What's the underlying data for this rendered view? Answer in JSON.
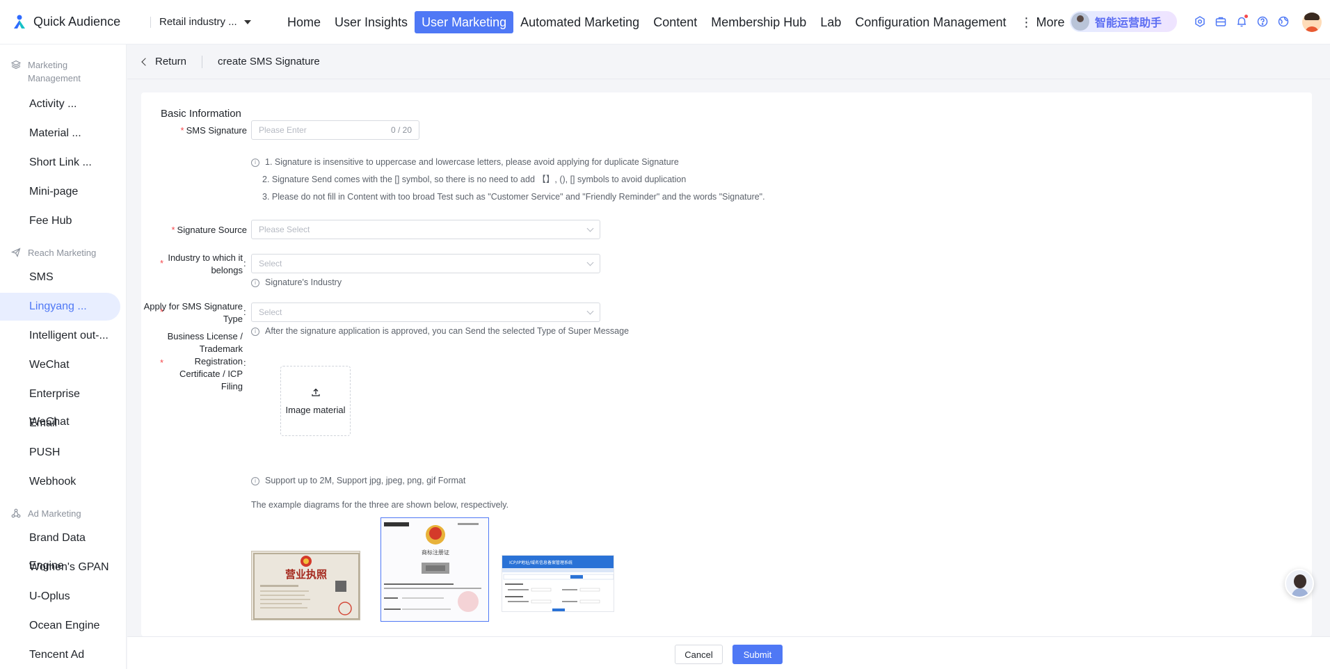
{
  "app": {
    "name": "Quick Audience",
    "org_selector": "Retail industry ...",
    "assistant_label": "智能运营助手"
  },
  "nav": [
    {
      "label": "Home"
    },
    {
      "label": "User Insights"
    },
    {
      "label": "User Marketing",
      "active": true
    },
    {
      "label": "Automated Marketing"
    },
    {
      "label": "Content"
    },
    {
      "label": "Membership Hub"
    },
    {
      "label": "Lab"
    },
    {
      "label": "Configuration Management"
    },
    {
      "label": "⋮ More"
    }
  ],
  "top_icons": [
    "settings-hex-icon",
    "toolbox-icon",
    "bell-icon",
    "help-icon",
    "globe-icon"
  ],
  "sidebar": {
    "groups": [
      {
        "label": "Marketing Management",
        "icon": "layers-icon",
        "items": [
          "Activity ...",
          "Material ...",
          "Short Link ...",
          "Mini-page",
          "Fee Hub"
        ]
      },
      {
        "label": "Reach Marketing",
        "icon": "send-icon",
        "items": [
          "SMS",
          "Lingyang ...",
          "Intelligent out-...",
          "WeChat",
          "Enterprise WeChat",
          "Email",
          "PUSH",
          "Webhook"
        ]
      },
      {
        "label": "Ad Marketing",
        "icon": "nodes-icon",
        "items": [
          "Brand Data Engine",
          "Women's GPAN",
          "U-Oplus",
          "Ocean Engine",
          "Tencent Ad"
        ]
      }
    ],
    "active_item": "Lingyang ..."
  },
  "breadcrumb": {
    "back_label": "Return",
    "title": "create SMS Signature"
  },
  "form": {
    "section_title": "Basic Information",
    "sms_signature": {
      "label": "SMS Signature",
      "placeholder": "Please Enter",
      "counter": "0 / 20",
      "tips": [
        "1. Signature is insensitive to uppercase and lowercase letters, please avoid applying for duplicate Signature",
        "2. Signature Send comes with the [] symbol, so there is no need to add 【】, (), [] symbols to avoid duplication",
        "3. Please do not fill in Content with too broad Test such as \"Customer Service\" and \"Friendly Reminder\" and the words \"Signature\"."
      ]
    },
    "signature_source": {
      "label": "Signature Source",
      "placeholder": "Please Select"
    },
    "industry": {
      "label": "Industry to which it belongs",
      "placeholder": "Select",
      "tip": "Signature's Industry"
    },
    "signature_type": {
      "label": "Apply for SMS Signature Type",
      "placeholder": "Select",
      "tip": "After the signature application is approved, you can Send the selected Type of Super Message"
    },
    "license": {
      "label": "Business License / Trademark Registration Certificate / ICP Filing",
      "upload_label": "Image material",
      "format_tip": "Support up to 2M, Support jpg, jpeg, png, gif Format",
      "examples_note": "The example diagrams for the three are shown below, respectively."
    }
  },
  "samples": {
    "license_title": "营业执照",
    "trademark_title": "商标注册证",
    "icp_title": "ICP/IP地址/域名信息备案管理系统"
  },
  "footer": {
    "cancel_label": "Cancel",
    "submit_label": "Submit"
  },
  "colors": {
    "accent": "#4f78f5",
    "required": "#f5484d"
  }
}
